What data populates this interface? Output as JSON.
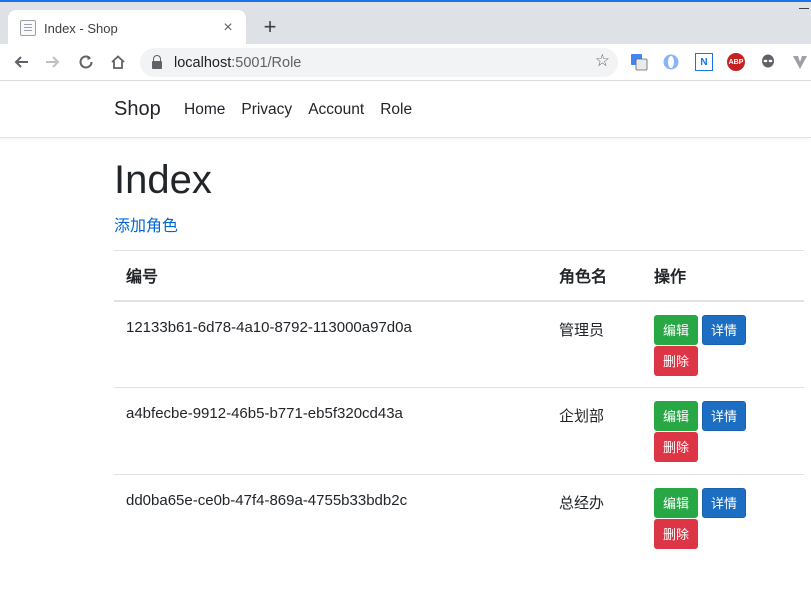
{
  "browser": {
    "tab_title": "Index - Shop",
    "tab_close": "×",
    "new_tab": "+",
    "url_host": "localhost",
    "url_path": ":5001/Role",
    "extensions": [
      "translate-icon",
      "opera-icon",
      "n-icon",
      "abp-icon",
      "alien-icon",
      "vivaldi-icon"
    ],
    "abp_label": "ABP",
    "n_label": "N"
  },
  "navbar": {
    "brand": "Shop",
    "links": [
      "Home",
      "Privacy",
      "Account",
      "Role"
    ]
  },
  "page": {
    "title": "Index",
    "add_link": "添加角色"
  },
  "table": {
    "headers": [
      "编号",
      "角色名",
      "操作"
    ],
    "rows": [
      {
        "id": "12133b61-6d78-4a10-8792-113000a97d0a",
        "name": "管理员"
      },
      {
        "id": "a4bfecbe-9912-46b5-b771-eb5f320cd43a",
        "name": "企划部"
      },
      {
        "id": "dd0ba65e-ce0b-47f4-869a-4755b33bdb2c",
        "name": "总经办"
      }
    ],
    "actions": {
      "edit": "编辑",
      "detail": "详情",
      "delete": "删除"
    }
  },
  "colors": {
    "accent": "#1a73e8",
    "link": "#0366d6",
    "edit": "#28a745",
    "detail": "#1b6ec2",
    "delete": "#dc3545"
  }
}
